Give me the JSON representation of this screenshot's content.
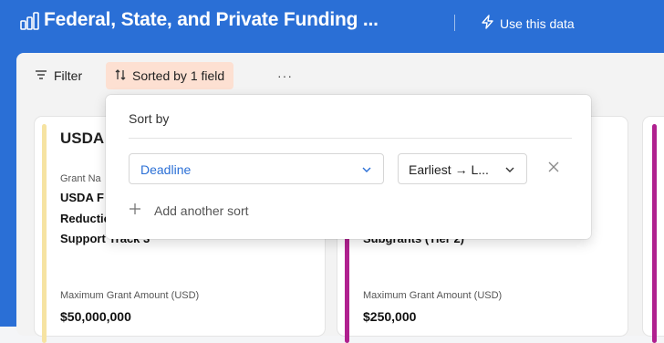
{
  "header": {
    "title": "Federal, State, and Private Funding ...",
    "use_data_label": "Use this data",
    "app_icon": "bar-chart-icon"
  },
  "toolbar": {
    "filter_label": "Filter",
    "sort_label": "Sorted by 1 field",
    "more_label": "···"
  },
  "cards": [
    {
      "title": "USDA",
      "field_label": "Grant Na",
      "lines": [
        "USDA F",
        "Reductio",
        "Support Track 3"
      ],
      "max_label": "Maximum Grant Amount (USD)",
      "max_value": "$50,000,000"
    },
    {
      "fragment_1": "-",
      "fragment_2": "Subgrants (Tier 2)",
      "max_label": "Maximum Grant Amount (USD)",
      "max_value": "$250,000"
    }
  ],
  "sort_popover": {
    "title": "Sort by",
    "field": "Deadline",
    "direction": "Earliest → L...",
    "add_label": "Add another sort"
  },
  "colors": {
    "brand_blue": "#2a6fd6",
    "sort_highlight": "#fde0d2",
    "card1_accent": "#f6e3a2",
    "card2_accent": "#b0218f"
  }
}
